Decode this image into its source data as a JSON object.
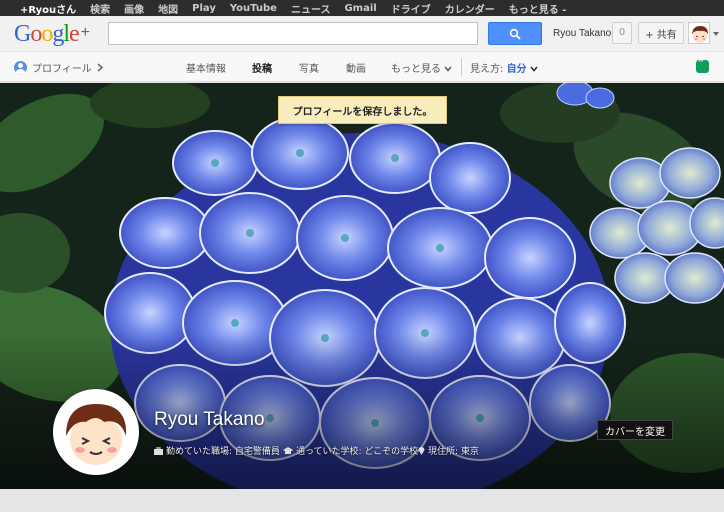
{
  "topbar": {
    "items": [
      "+Ryouさん",
      "検索",
      "画像",
      "地図",
      "Play",
      "YouTube",
      "ニュース",
      "Gmail",
      "ドライブ",
      "カレンダー",
      "もっと見る -"
    ]
  },
  "header": {
    "logo_text": "Google",
    "logo_plus": "+",
    "search_value": "",
    "search_icon": "search-icon",
    "user_name": "Ryou Takano",
    "notification_count": "0",
    "share_label": "+ 共有"
  },
  "profile_nav": {
    "profile_link": "プロフィール",
    "tabs": [
      "基本情報",
      "投稿",
      "写真",
      "動画",
      "もっと見る"
    ],
    "active_tab": "投稿",
    "view_label": "見え方:",
    "view_value": "自分"
  },
  "cover": {
    "toast": "プロフィールを保存しました。",
    "name": "Ryou Takano",
    "work": "勤めていた職場: 自宅警備員",
    "school": "通っていた学校: どこぞの学校",
    "location": "現住所: 東京",
    "change_cover": "カバーを変更"
  },
  "colors": {
    "accent": "#4d90fe",
    "toast_bg": "#f9edbe",
    "view_value": "#3366cc",
    "hangout": "#0f9d58"
  }
}
